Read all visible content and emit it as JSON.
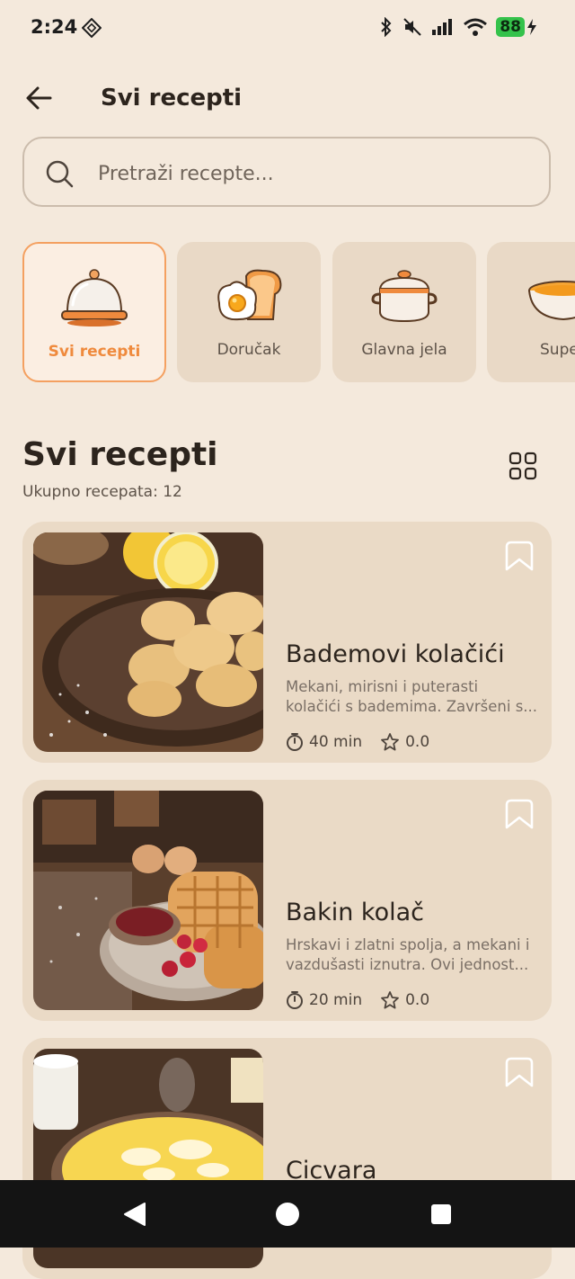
{
  "status_bar": {
    "time": "2:24",
    "battery": "88"
  },
  "header": {
    "title": "Svi recepti"
  },
  "search": {
    "placeholder": "Pretraži recepte..."
  },
  "categories": [
    {
      "label": "Svi recepti",
      "icon": "cloche-icon",
      "active": true
    },
    {
      "label": "Doručak",
      "icon": "egg-toast-icon",
      "active": false
    },
    {
      "label": "Glavna jela",
      "icon": "pot-icon",
      "active": false
    },
    {
      "label": "Supe",
      "icon": "soup-bowl-icon",
      "active": false
    }
  ],
  "section": {
    "title": "Svi recepti",
    "count": "Ukupno recepata: 12"
  },
  "recipes": [
    {
      "name": "Bademovi kolačići",
      "desc1": "Mekani, mirisni i puterasti",
      "desc2": "kolačići s bademima. Završeni s...",
      "time": "40 min",
      "rating": "0.0"
    },
    {
      "name": "Bakin kolač",
      "desc1": "Hrskavi i zlatni spolja, a mekani i",
      "desc2": "vazdušasti iznutra. Ovi jednost...",
      "time": "20 min",
      "rating": "0.0"
    },
    {
      "name": "Cicvara",
      "desc1": "",
      "desc2": "",
      "time": "",
      "rating": ""
    }
  ],
  "colors": {
    "background": "#f4e9dc",
    "card": "#eadac6",
    "accent": "#ef8a3d"
  }
}
